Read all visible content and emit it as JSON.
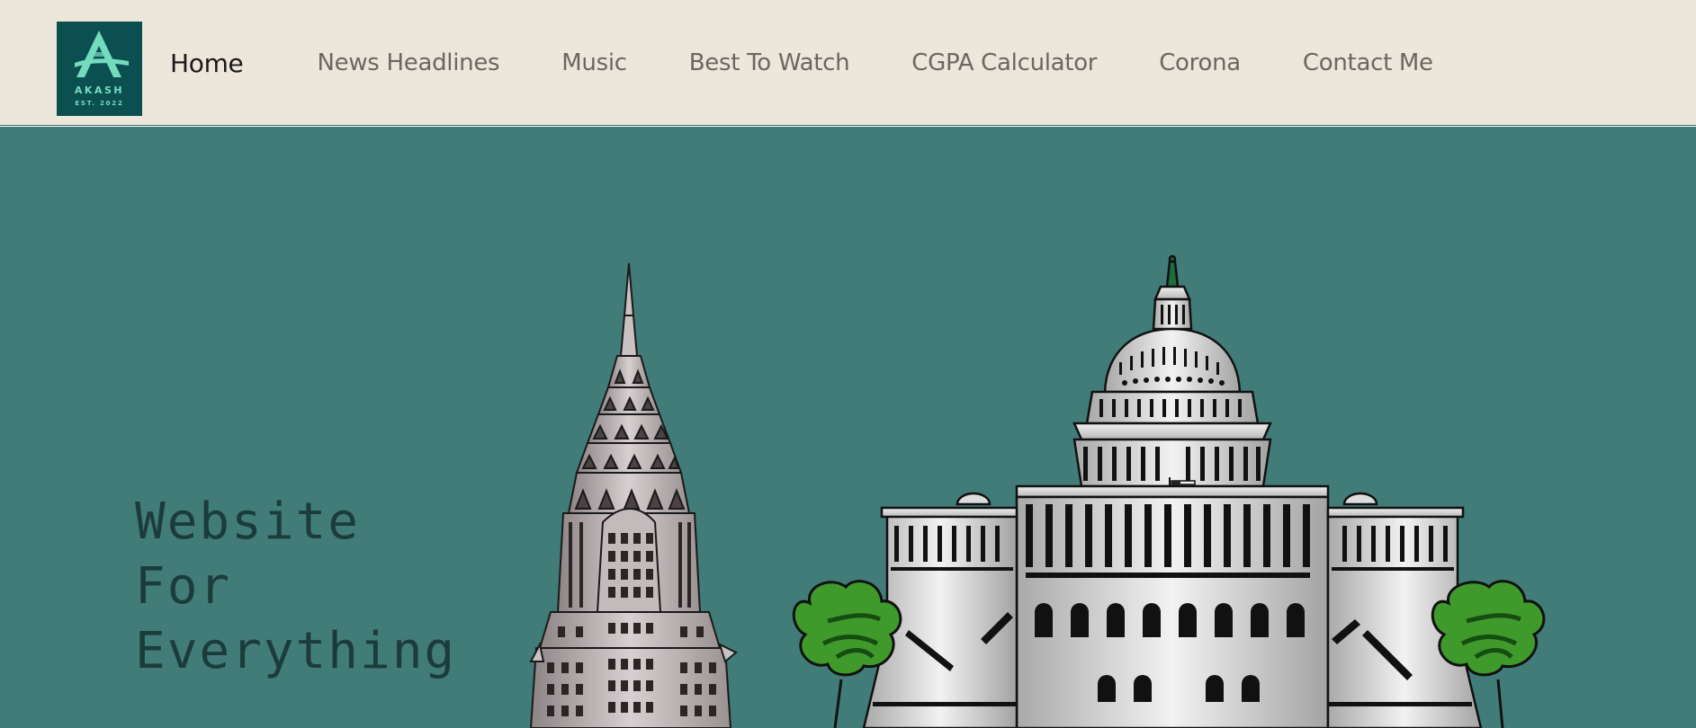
{
  "colors": {
    "navbar_bg": "#ede6da",
    "hero_bg": "#417c79",
    "active_link": "#1a1a1a",
    "link": "#6a6762",
    "tagline": "#1c3c3c",
    "logo_bg": "#0b4f50",
    "logo_mark": "#74dcbe"
  },
  "logo": {
    "text": "AKASH",
    "est": "EST. 2022"
  },
  "nav": {
    "items": [
      {
        "label": "Home",
        "active": true
      },
      {
        "label": "News Headlines"
      },
      {
        "label": "Music"
      },
      {
        "label": "Best To Watch"
      },
      {
        "label": "CGPA Calculator"
      },
      {
        "label": "Corona"
      },
      {
        "label": "Contact Me"
      }
    ]
  },
  "hero": {
    "tagline": [
      "Website",
      "For",
      "Everything"
    ]
  }
}
